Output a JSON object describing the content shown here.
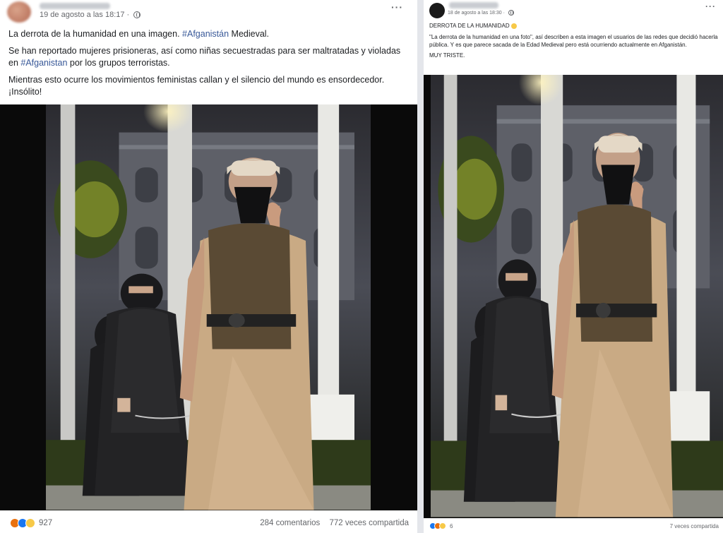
{
  "left_post": {
    "timestamp": "19 de agosto a las 18:17 ·",
    "more_label": "···",
    "line1_text": "La derrota de la humanidad en una imagen.",
    "line1_tag": "#Afganistán",
    "line1_after": " Medieval.",
    "line2_text": "Se han reportado mujeres prisioneras, así como niñas secuestradas para ser maltratadas y violadas en ",
    "line2_tag": "#Afganistan",
    "line2_after": " por los grupos terroristas.",
    "line3_text": "Mientras esto ocurre los movimientos feministas callan y el silencio del mundo es ensordecedor. ¡Insólito!",
    "reaction_count": "927",
    "comments": "284 comentarios",
    "shares": "772 veces compartida"
  },
  "right_post": {
    "timestamp": "18 de agosto a las 18:30 ·",
    "more_label": "···",
    "title": "DERROTA DE LA HUMANIDAD",
    "body": "\"La derrota de la humanidad en una foto\", así describen a esta imagen el usuarios de las redes que decidió hacerla pública. Y es que parece sacada de la Edad Medieval pero está ocurriendo actualmente en Afganistán.",
    "closing": "MUY TRISTE.",
    "reaction_count": "6",
    "shares": "7 veces compartida"
  },
  "icons": {
    "reactions": [
      "angry-icon",
      "like-icon",
      "sad-icon"
    ],
    "colors": {
      "angry": "#e9710f",
      "like": "#1877f2",
      "sad": "#f7c948",
      "hashtag": "#385898"
    }
  }
}
